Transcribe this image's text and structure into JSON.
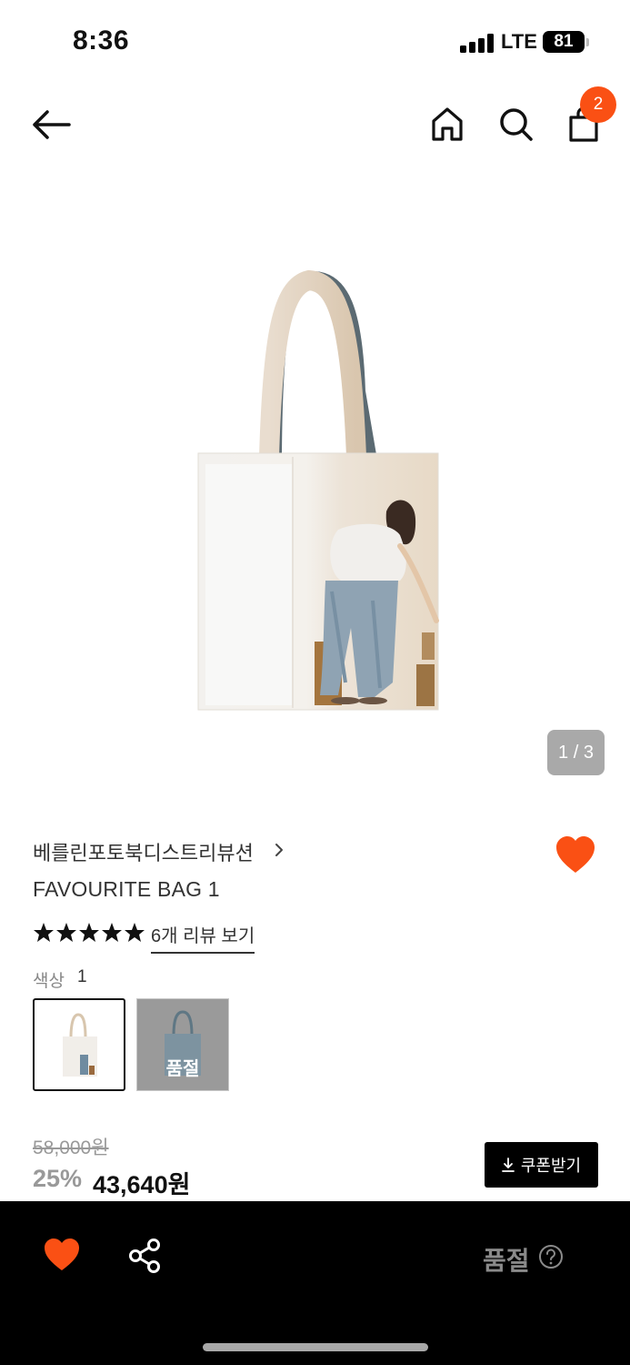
{
  "status_bar": {
    "time": "8:36",
    "network": "LTE",
    "battery": "81"
  },
  "nav": {
    "cart_count": "2"
  },
  "gallery": {
    "indicator": "1 / 3"
  },
  "product": {
    "brand": "베를린포토북디스트리뷰션",
    "name": "FAVOURITE BAG 1",
    "rating_stars": 5,
    "review_link": "6개 리뷰 보기",
    "color_label": "색상",
    "color_value": "1",
    "swatches": [
      {
        "label": "",
        "selected": true
      },
      {
        "label": "품절",
        "selected": false
      }
    ]
  },
  "price": {
    "original": "58,000원",
    "discount": "25%",
    "sale": "43,640원",
    "coupon_button": "쿠폰받기"
  },
  "bottom_bar": {
    "status": "품절"
  },
  "colors": {
    "accent": "#fa5014",
    "black": "#000000",
    "muted": "#999999"
  },
  "icons": [
    "back-arrow-icon",
    "home-icon",
    "search-icon",
    "shopping-bag-icon",
    "heart-icon",
    "star-icon",
    "download-icon",
    "share-icon",
    "help-icon",
    "chevron-right-icon"
  ]
}
